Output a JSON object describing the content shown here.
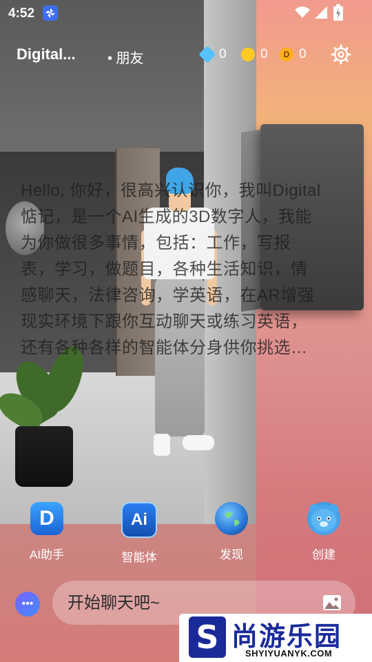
{
  "status_bar": {
    "time": "4:52"
  },
  "header": {
    "title": "Digital...",
    "friends_label": "• 朋友",
    "currencies": [
      {
        "icon": "diamond-icon",
        "value": "0",
        "color": "#56c3ff"
      },
      {
        "icon": "gold-coin-icon",
        "value": "0",
        "color": "#ffca21"
      },
      {
        "icon": "d-coin-icon",
        "value": "0",
        "color": "#ffb11a"
      }
    ]
  },
  "coin_glyph": "D",
  "message": {
    "text": "Hello, 你好，很高兴认识你，我叫Digital惦记，是一个AI生成的3D数字人，我能为你做很多事情，包括：工作，写报表，学习，做题目，各种生活知识，情感聊天，法律咨询，学英语，在AR增强现实环境下跟你互动聊天或练习英语，还有各种各样的智能体分身供你挑选…"
  },
  "nav": {
    "items": [
      {
        "label": "AI助手",
        "icon": "ai-assistant-icon",
        "glyph": "D"
      },
      {
        "label": "智能体",
        "icon": "agent-icon",
        "glyph": "Ai"
      },
      {
        "label": "发现",
        "icon": "globe-icon",
        "glyph": ""
      },
      {
        "label": "创建",
        "icon": "bear-icon",
        "glyph": ""
      }
    ]
  },
  "chat": {
    "placeholder": "开始聊天吧~",
    "bot_glyph": "•••"
  },
  "watermark": {
    "logo_letter": "S",
    "name": "尚游乐园",
    "domain": "SHYIYUANYK.COM"
  }
}
